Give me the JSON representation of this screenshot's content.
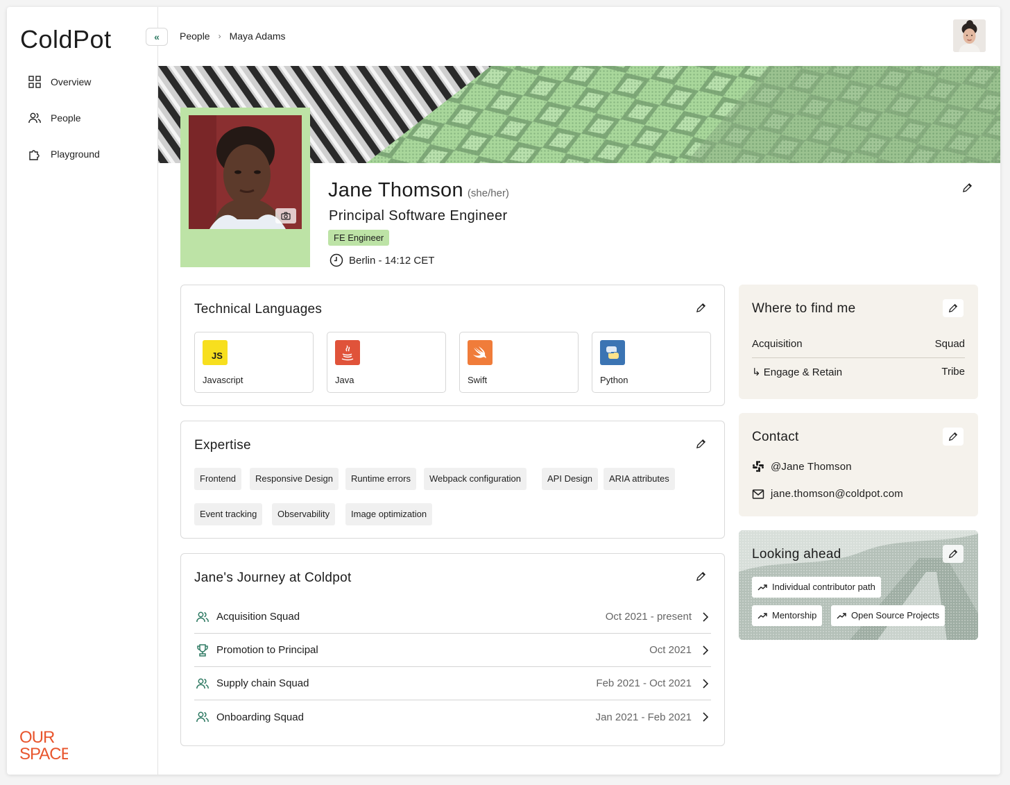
{
  "app": {
    "name": "ColdPot"
  },
  "sidebar": {
    "items": [
      {
        "label": "Overview",
        "icon": "grid-icon"
      },
      {
        "label": "People",
        "icon": "people-icon"
      },
      {
        "label": "Playground",
        "icon": "puzzle-icon"
      }
    ],
    "footer_logo": {
      "line1": "OUR",
      "line2": "SPACE",
      "color": "#e8552d"
    }
  },
  "header": {
    "collapse_label": "«",
    "breadcrumb": [
      "People",
      "Maya Adams"
    ],
    "breadcrumb_separator": "›"
  },
  "profile": {
    "name": "Jane Thomson",
    "pronouns": "(she/her)",
    "role": "Principal Software Engineer",
    "badge": "FE Engineer",
    "location": "Berlin - 14:12 CET",
    "accent_color": "#bde3a6"
  },
  "technical_languages": {
    "title": "Technical Languages",
    "items": [
      {
        "name": "Javascript",
        "icon": "js-icon",
        "icon_text": "JS",
        "color": "#f7df1e"
      },
      {
        "name": "Java",
        "icon": "java-icon",
        "color": "#e76f51"
      },
      {
        "name": "Swift",
        "icon": "swift-icon",
        "color": "#f05138"
      },
      {
        "name": "Python",
        "icon": "python-icon",
        "color": "#3776ab"
      }
    ]
  },
  "expertise": {
    "title": "Expertise",
    "tags": [
      "Frontend",
      "Responsive Design",
      "Runtime errors",
      "Webpack configuration",
      "API Design",
      "ARIA attributes",
      "Event tracking",
      "Observability",
      "Image optimization"
    ]
  },
  "journey": {
    "title": "Jane's Journey at Coldpot",
    "items": [
      {
        "label": "Acquisition Squad",
        "date": "Oct 2021 - present",
        "icon": "people-icon"
      },
      {
        "label": "Promotion to Principal",
        "date": "Oct 2021",
        "icon": "trophy-icon"
      },
      {
        "label": "Supply chain Squad",
        "date": "Feb 2021 - Oct 2021",
        "icon": "people-icon"
      },
      {
        "label": "Onboarding Squad",
        "date": "Jan 2021 - Feb 2021",
        "icon": "people-icon"
      }
    ]
  },
  "where_to_find": {
    "title": "Where to find me",
    "rows": [
      {
        "name": "Acquisition",
        "type": "Squad"
      },
      {
        "name": "↳ Engage & Retain",
        "type": "Tribe"
      }
    ]
  },
  "contact": {
    "title": "Contact",
    "slack": "@Jane Thomson",
    "email": "jane.thomson@coldpot.com"
  },
  "looking_ahead": {
    "title": "Looking ahead",
    "items": [
      "Individual contributor path",
      "Mentorship",
      "Open Source Projects"
    ]
  }
}
